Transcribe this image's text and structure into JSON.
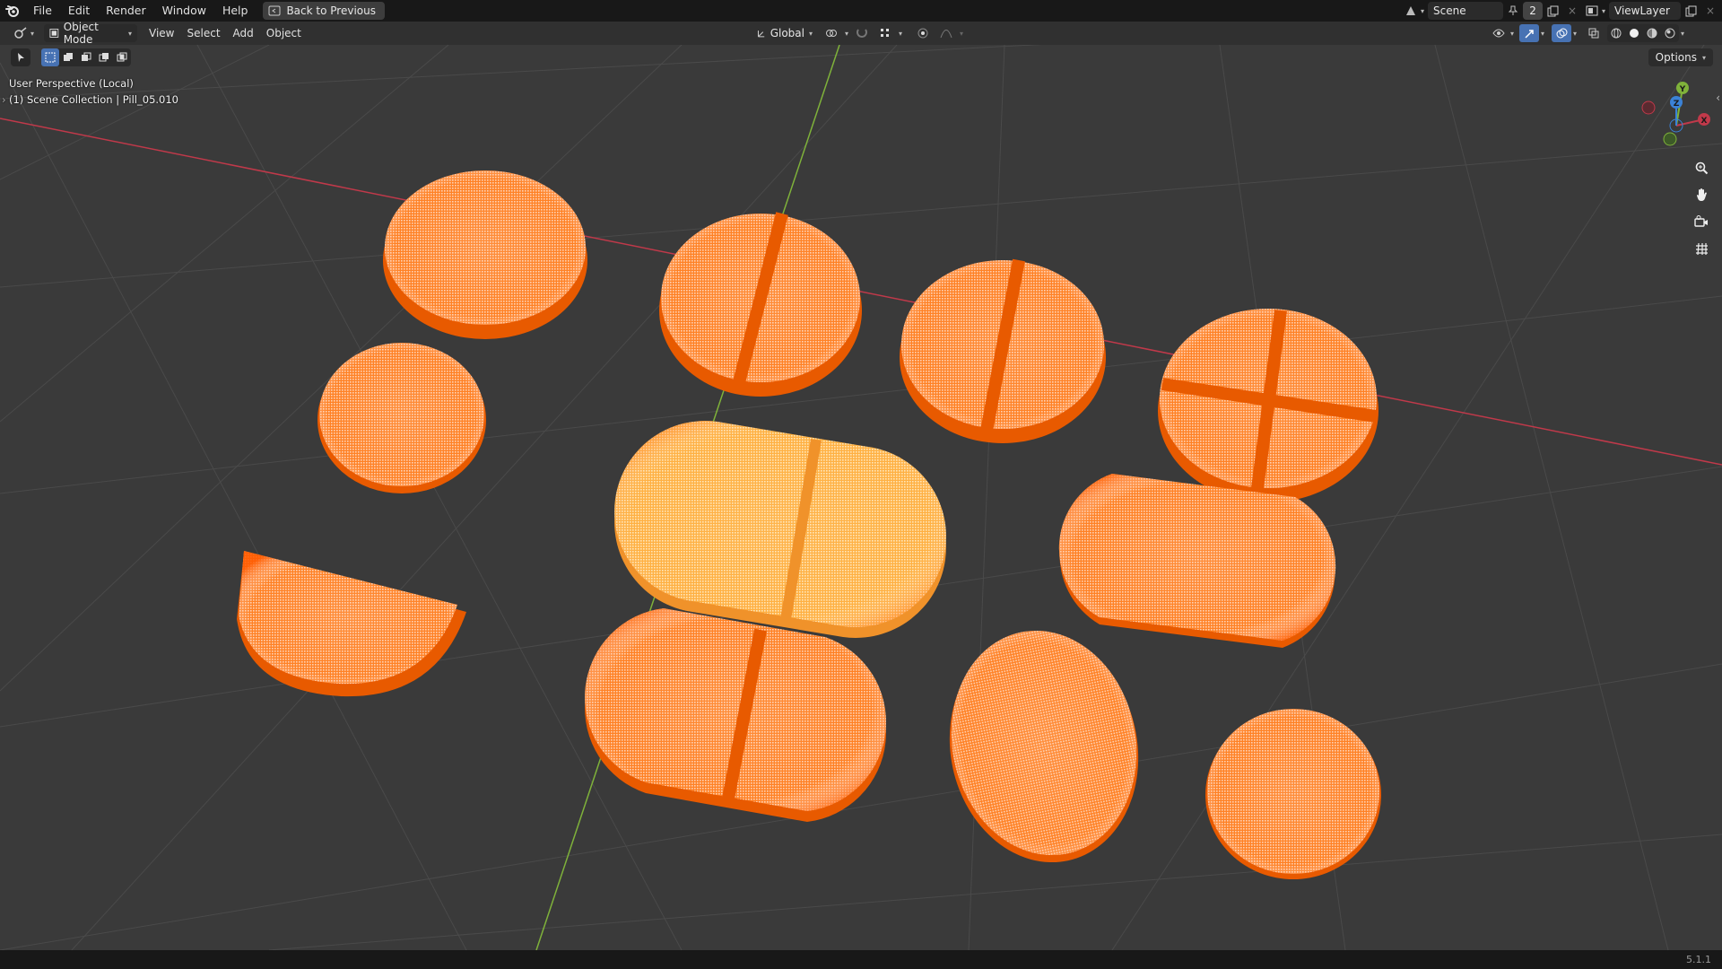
{
  "topbar": {
    "menus": [
      "File",
      "Edit",
      "Render",
      "Window",
      "Help"
    ],
    "back_label": "Back to Previous",
    "scene_name": "Scene",
    "scene_count": "2",
    "view_layer": "ViewLayer"
  },
  "header": {
    "mode": "Object Mode",
    "menus": [
      "View",
      "Select",
      "Add",
      "Object"
    ],
    "transform_orientation": "Global"
  },
  "viewport": {
    "perspective": "User Perspective (Local)",
    "collection": "(1) Scene Collection | Pill_05.010",
    "options_label": "Options",
    "gizmo": {
      "x": "X",
      "y": "Y",
      "z": "Z"
    },
    "colors": {
      "background": "#3a3a3a",
      "grid": "#4a4a4a",
      "x_axis": "#c0394a",
      "y_axis": "#7fb23a",
      "selected": "#ff6a0a",
      "active": "#ffa12e"
    }
  },
  "statusbar": {
    "version": "5.1.1"
  },
  "icons": [
    "blender-logo-icon",
    "back-icon",
    "scene-icon",
    "pin-icon",
    "new-scene-icon",
    "viewlayer-icon",
    "editor-type-icon",
    "object-mode-icon",
    "transform-icon",
    "pivot-icon",
    "snap-icon",
    "proportional-icon",
    "visibility-icon",
    "gizmo-icon",
    "overlay-icon",
    "xray-icon",
    "shading-wire-icon",
    "shading-solid-icon",
    "shading-material-icon",
    "shading-render-icon",
    "zoom-icon",
    "pan-icon",
    "camera-icon",
    "grid-icon"
  ]
}
